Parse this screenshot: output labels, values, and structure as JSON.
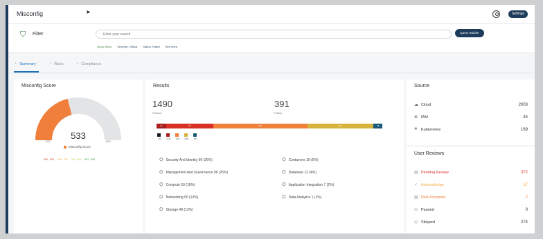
{
  "app": {
    "title": "Misconfig",
    "settings_label": "Settings"
  },
  "filter": {
    "label": "Filter",
    "search_placeholder": "Enter your search",
    "query_builder_label": "Query Builder",
    "quick_links": [
      "Quick Menu",
      "Severity: Critical",
      "Status: Failed",
      "See more"
    ]
  },
  "tabs": [
    {
      "label": "Summary",
      "icon": "summary-icon",
      "active": true
    },
    {
      "label": "Risks",
      "icon": "risk-icon",
      "active": false
    },
    {
      "label": "Compliance",
      "icon": "compliance-icon",
      "active": false
    }
  ],
  "score": {
    "title": "Misconfig Score",
    "value": "533",
    "min": "300",
    "max": "850",
    "legend_label": "Misconfig Score",
    "ranges": [
      {
        "label": "300 - 500",
        "color": "#d93025"
      },
      {
        "label": "500 - 700",
        "color": "#f2a93b"
      },
      {
        "label": "700 - 800",
        "color": "#c7c94a"
      },
      {
        "label": "801 - 850",
        "color": "#3a9a3a"
      }
    ],
    "fill_fraction": 0.42
  },
  "results": {
    "title": "Results",
    "passed_value": "1490",
    "passed_label": "Passed",
    "failed_value": "391",
    "failed_label": "Failed",
    "bar": [
      {
        "label": "12",
        "color": "#a81e1e",
        "fraction": 0.04
      },
      {
        "label": "78",
        "color": "#d93025",
        "fraction": 0.2
      },
      {
        "label": "160",
        "color": "#f07f3c",
        "fraction": 0.4
      },
      {
        "label": "107",
        "color": "#d6b33a",
        "fraction": 0.28
      },
      {
        "label": "18",
        "color": "#1d5a7a",
        "fraction": 0.04
      }
    ],
    "severity_legend": [
      {
        "pct": "4%",
        "color": "#1a1a1a"
      },
      {
        "pct": "21%",
        "color": "#a81e1e"
      },
      {
        "pct": "40%",
        "color": "#f07f3c"
      },
      {
        "pct": "28%",
        "color": "#d6b33a"
      },
      {
        "pct": "5%",
        "color": "#1d5a7a"
      }
    ],
    "categories_left": [
      "Security And Identity 99 (26%)",
      "Management And Governance 96 (25%)",
      "Compute 59 (16%)",
      "Networking 50 (13%)",
      "Storage 49 (13%)"
    ],
    "categories_right": [
      "Containers 18 (5%)",
      "Database 12 (4%)",
      "Application Integration 7 (2%)",
      "Data Analytics 1 (1%)"
    ]
  },
  "source": {
    "title": "Source",
    "items": [
      {
        "label": "Cloud",
        "count": "2003",
        "icon": "cloud-icon"
      },
      {
        "label": "IAM",
        "count": "44",
        "icon": "iam-icon"
      },
      {
        "label": "Kubernetes",
        "count": "169",
        "icon": "kubernetes-icon"
      }
    ]
  },
  "reviews": {
    "title": "User Reviews",
    "items": [
      {
        "label": "Pending Review",
        "count": "372",
        "color": "#d93025",
        "icon": "pending-icon"
      },
      {
        "label": "Acknowledge",
        "count": "17",
        "color": "#f2a93b",
        "icon": "acknowledge-icon"
      },
      {
        "label": "Risk Accepted",
        "count": "2",
        "color": "#f07f3c",
        "icon": "risk-accepted-icon"
      },
      {
        "label": "Paused",
        "count": "0",
        "color": "#2b2f36",
        "icon": "paused-icon"
      },
      {
        "label": "Skipped",
        "count": "274",
        "color": "#2b2f36",
        "icon": "skipped-icon"
      }
    ]
  }
}
